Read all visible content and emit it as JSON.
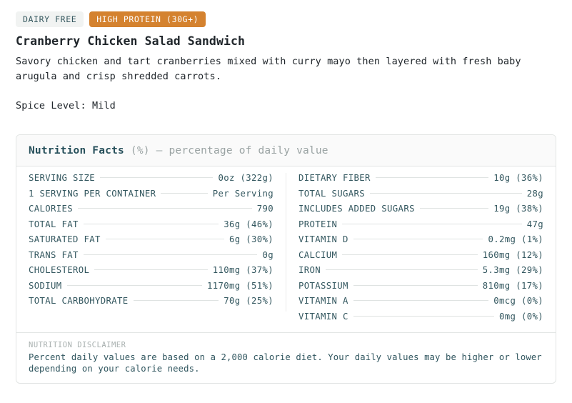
{
  "badges": [
    {
      "label": "DAIRY FREE",
      "style": "plain"
    },
    {
      "label": "HIGH PROTEIN (30G+)",
      "style": "accent"
    }
  ],
  "item": {
    "title": "Cranberry Chicken Salad Sandwich",
    "description": "Savory chicken and tart cranberries mixed with curry mayo then layered with fresh baby arugula and crisp shredded carrots.",
    "spice_level": "Spice Level: Mild"
  },
  "nutrition": {
    "header_title": "Nutrition Facts",
    "header_subtitle": "(%) – percentage of daily value",
    "left_column": [
      {
        "label": "SERVING SIZE",
        "value": "0oz (322g)"
      },
      {
        "label": "1 SERVING PER CONTAINER",
        "value": "Per Serving"
      },
      {
        "label": "CALORIES",
        "value": "790"
      },
      {
        "label": "TOTAL FAT",
        "value": "36g (46%)"
      },
      {
        "label": "SATURATED FAT",
        "value": "6g (30%)"
      },
      {
        "label": "TRANS FAT",
        "value": "0g"
      },
      {
        "label": "CHOLESTEROL",
        "value": "110mg (37%)"
      },
      {
        "label": "SODIUM",
        "value": "1170mg (51%)"
      },
      {
        "label": "TOTAL CARBOHYDRATE",
        "value": "70g (25%)"
      }
    ],
    "right_column": [
      {
        "label": "DIETARY FIBER",
        "value": "10g (36%)"
      },
      {
        "label": "TOTAL SUGARS",
        "value": "28g"
      },
      {
        "label": "INCLUDES ADDED SUGARS",
        "value": "19g (38%)"
      },
      {
        "label": "PROTEIN",
        "value": "47g"
      },
      {
        "label": "VITAMIN D",
        "value": "0.2mg (1%)"
      },
      {
        "label": "CALCIUM",
        "value": "160mg (12%)"
      },
      {
        "label": "IRON",
        "value": "5.3mg (29%)"
      },
      {
        "label": "POTASSIUM",
        "value": "810mg (17%)"
      },
      {
        "label": "VITAMIN A",
        "value": "0mcg (0%)"
      },
      {
        "label": "VITAMIN C",
        "value": "0mg (0%)"
      }
    ]
  },
  "disclaimer": {
    "label": "NUTRITION DISCLAIMER",
    "text": "Percent daily values are based on a 2,000 calorie diet. Your daily values may be higher or lower depending on your calorie needs."
  },
  "colors": {
    "accent_badge_bg": "#d4822f",
    "plain_badge_bg": "#f1f3f2",
    "text_teal": "#33575f",
    "muted": "#9aa3a3",
    "card_border": "#e2e5e4"
  }
}
